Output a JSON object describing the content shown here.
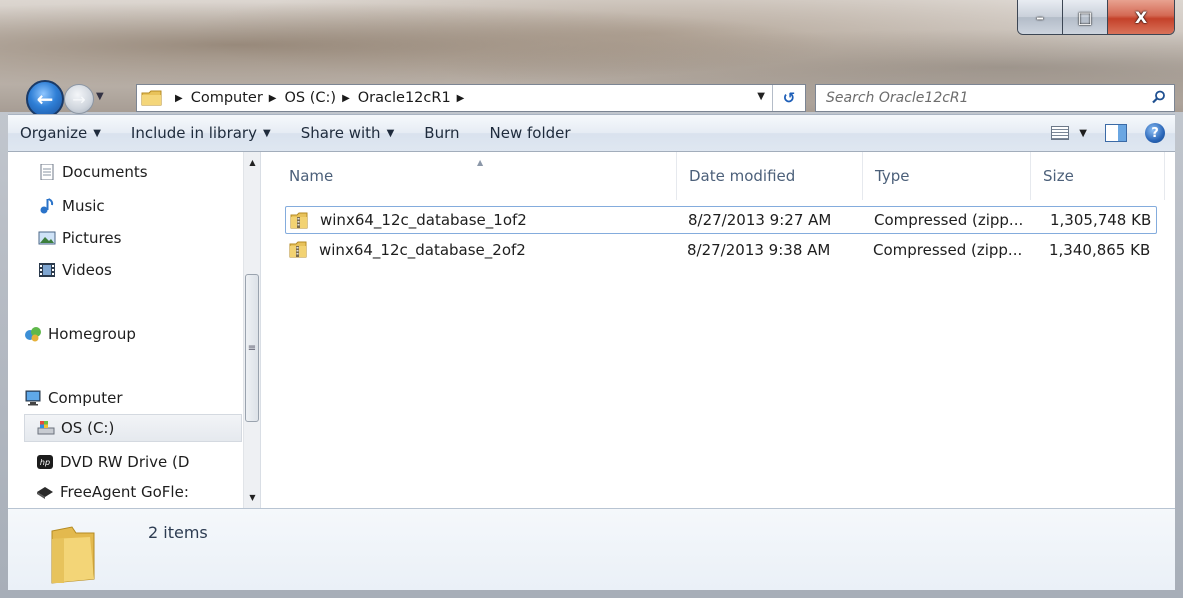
{
  "window": {
    "caption_buttons": {
      "minimize": "–",
      "maximize": "□",
      "close": "X"
    }
  },
  "nav": {
    "back_glyph": "←",
    "forward_glyph": "→",
    "breadcrumbs": [
      "Computer",
      "OS (C:)",
      "Oracle12cR1"
    ],
    "search_placeholder": "Search Oracle12cR1"
  },
  "toolbar": {
    "organize": "Organize",
    "include_in_library": "Include in library",
    "share_with": "Share with",
    "burn": "Burn",
    "new_folder": "New folder",
    "help": "?"
  },
  "sidebar": {
    "items": [
      {
        "label": "Documents",
        "icon": "documents-icon"
      },
      {
        "label": "Music",
        "icon": "music-icon"
      },
      {
        "label": "Pictures",
        "icon": "pictures-icon"
      },
      {
        "label": "Videos",
        "icon": "videos-icon"
      },
      {
        "label": "Homegroup",
        "icon": "homegroup-icon"
      },
      {
        "label": "Computer",
        "icon": "computer-icon"
      },
      {
        "label": "OS (C:)",
        "icon": "drive-icon",
        "selected": true
      },
      {
        "label": "DVD RW Drive (D",
        "icon": "dvd-drive-icon"
      },
      {
        "label": "FreeAgent GoFle:",
        "icon": "external-drive-icon"
      }
    ]
  },
  "file_list": {
    "columns": [
      "Name",
      "Date modified",
      "Type",
      "Size"
    ],
    "rows": [
      {
        "name": "winx64_12c_database_1of2",
        "date_modified": "8/27/2013 9:27 AM",
        "type": "Compressed (zipp...",
        "size": "1,305,748 KB",
        "selected": true
      },
      {
        "name": "winx64_12c_database_2of2",
        "date_modified": "8/27/2013 9:38 AM",
        "type": "Compressed (zipp...",
        "size": "1,340,865 KB",
        "selected": false
      }
    ]
  },
  "details": {
    "item_count": "2 items"
  },
  "colors": {
    "accent": "#2f7fd6",
    "header_text": "#4c607a",
    "selection_border": "#84acdd"
  }
}
